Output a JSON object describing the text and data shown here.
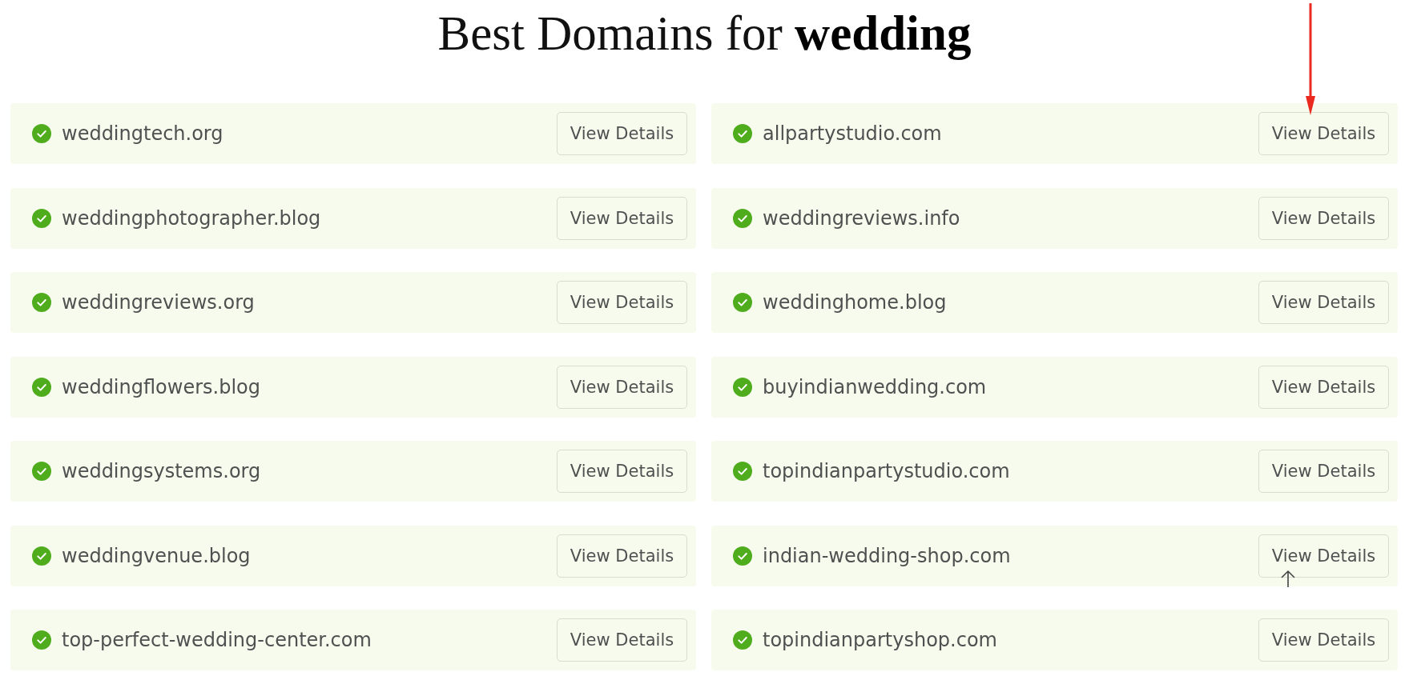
{
  "title": "Best Domains for **wedding**",
  "domains": [
    {
      "name": "weddingtech.org",
      "available": true,
      "button": "View Details"
    },
    {
      "name": "allpartystudio.com",
      "available": true,
      "button": "View Details"
    },
    {
      "name": "weddingphotographer.blog",
      "available": true,
      "button": "View Details"
    },
    {
      "name": "weddingreviews.info",
      "available": true,
      "button": "View Details"
    },
    {
      "name": "weddingreviews.org",
      "available": true,
      "button": "View Details"
    },
    {
      "name": "weddinghome.blog",
      "available": true,
      "button": "View Details"
    },
    {
      "name": "weddingflowers.blog",
      "available": true,
      "button": "View Details"
    },
    {
      "name": "buyindianwedding.com",
      "available": true,
      "button": "View Details"
    },
    {
      "name": "weddingsystems.org",
      "available": true,
      "button": "View Details"
    },
    {
      "name": "topindianpartystudio.com",
      "available": true,
      "button": "View Details"
    },
    {
      "name": "weddingvenue.blog",
      "available": true,
      "button": "View Details"
    },
    {
      "name": "indian-wedding-shop.com",
      "available": true,
      "button": "View Details"
    },
    {
      "name": "top-perfect-wedding-center.com",
      "available": true,
      "button": "View Details"
    },
    {
      "name": "topindianpartyshop.com",
      "available": true,
      "button": "View Details"
    }
  ]
}
